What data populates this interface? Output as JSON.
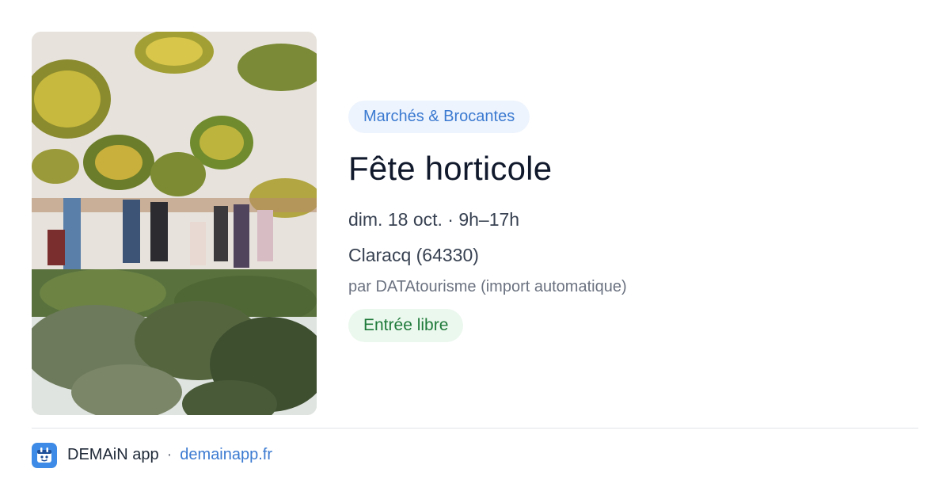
{
  "event": {
    "category": "Marchés & Brocantes",
    "title": "Fête horticole",
    "date_time": "dim. 18 oct. · 9h–17h",
    "location": "Claracq (64330)",
    "source": "par DATAtourisme (import automatique)",
    "price": "Entrée libre"
  },
  "footer": {
    "app_name": "DEMAiN app",
    "separator": "·",
    "site": "demainapp.fr",
    "logo_icon": "calendar-icon"
  },
  "colors": {
    "category_bg": "#eef4fd",
    "category_text": "#3b7ad1",
    "price_bg": "#ebf8ee",
    "price_text": "#1f7a3a",
    "brand": "#3d8be6"
  }
}
